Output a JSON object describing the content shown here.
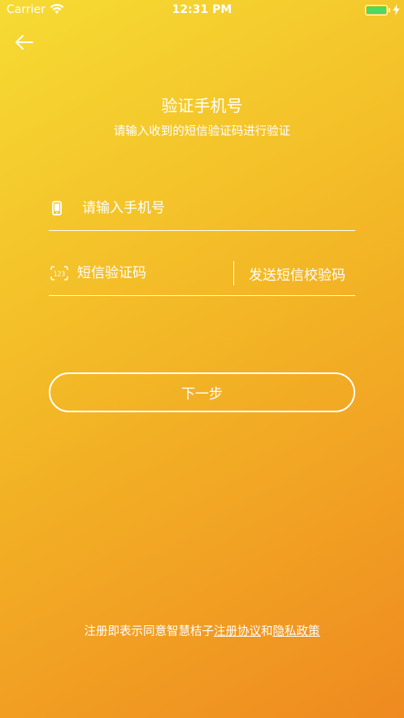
{
  "status_bar": {
    "carrier": "Carrier",
    "time": "12:31 PM",
    "battery_color": "#4cd964"
  },
  "header": {
    "back_icon": "arrow-left-icon"
  },
  "title": "验证手机号",
  "subtitle": "请输入收到的短信验证码进行验证",
  "phone_field": {
    "icon": "phone-icon",
    "value": "",
    "placeholder": "请输入手机号"
  },
  "code_field": {
    "icon": "keypad-123-icon",
    "value": "",
    "placeholder": "短信验证码",
    "send_label": "发送短信校验码"
  },
  "next_button": {
    "label": "下一步"
  },
  "footer": {
    "prefix": "注册即表示同意智慧桔子",
    "agreement_link": "注册协议",
    "conjunction": "和",
    "privacy_link": "隐私政策"
  },
  "colors": {
    "gradient_start": "#f6db33",
    "gradient_mid": "#f3b826",
    "gradient_end": "#ef8a20",
    "text": "#ffffff"
  }
}
